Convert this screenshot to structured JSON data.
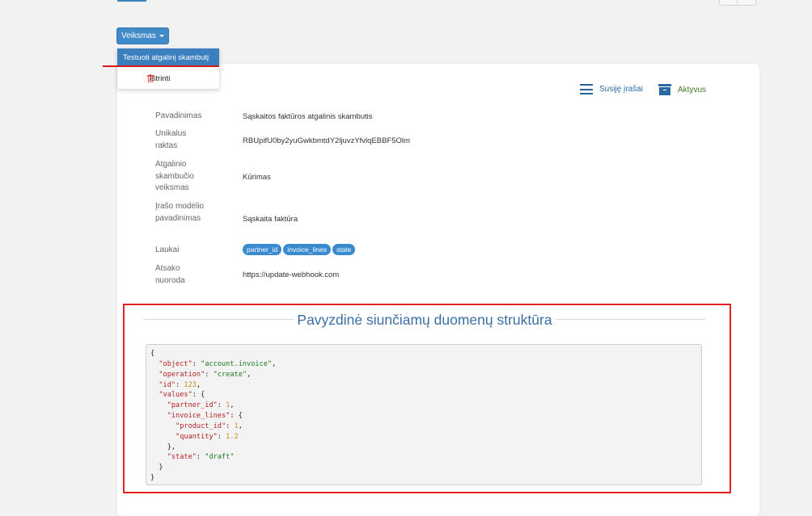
{
  "action_button": {
    "label": "Veiksmas"
  },
  "dropdown": {
    "items": [
      {
        "label": "Testuoti atgalinį skambutį"
      },
      {
        "label": "Ištrinti",
        "icon": "trash-icon"
      }
    ]
  },
  "header_links": {
    "related": {
      "label": "Susiję įrašai",
      "icon": "hamburger-icon"
    },
    "active": {
      "label": "Aktyvus",
      "icon": "archive-icon"
    }
  },
  "fields": {
    "name": {
      "label": "Pavadinimas",
      "value": "Sąskaitos faktūros atgalinis skambutis"
    },
    "unique_key": {
      "label": "Unikalus raktas",
      "value": "RBUpifU0by2yuGwkbmtdY2ljuvzYfvlqEBBF5Olm"
    },
    "callback_action": {
      "label": "Atgalinio skambučio veiksmas",
      "value": "Kūrimas"
    },
    "model_name": {
      "label": "Įrašo modėlio pavadinimas",
      "value": "Sąskaita faktūra"
    },
    "fields_label": {
      "label": "Laukai",
      "values": [
        "partner_id",
        "invoice_lines",
        "state"
      ]
    },
    "reply_url": {
      "label": "Atsako nuoroda",
      "value": "https://update-webhook.com"
    }
  },
  "section": {
    "title": "Pavyzdinė siunčiamų duomenų struktūra"
  },
  "code": {
    "object": "account.invoice",
    "operation": "create",
    "id": 123,
    "partner_id": 1,
    "product_id": 1,
    "quantity": 1.2,
    "state": "draft"
  },
  "colors": {
    "accent": "#3f8ac7",
    "highlight_red": "#e52222",
    "active_green": "#3d7a24"
  }
}
